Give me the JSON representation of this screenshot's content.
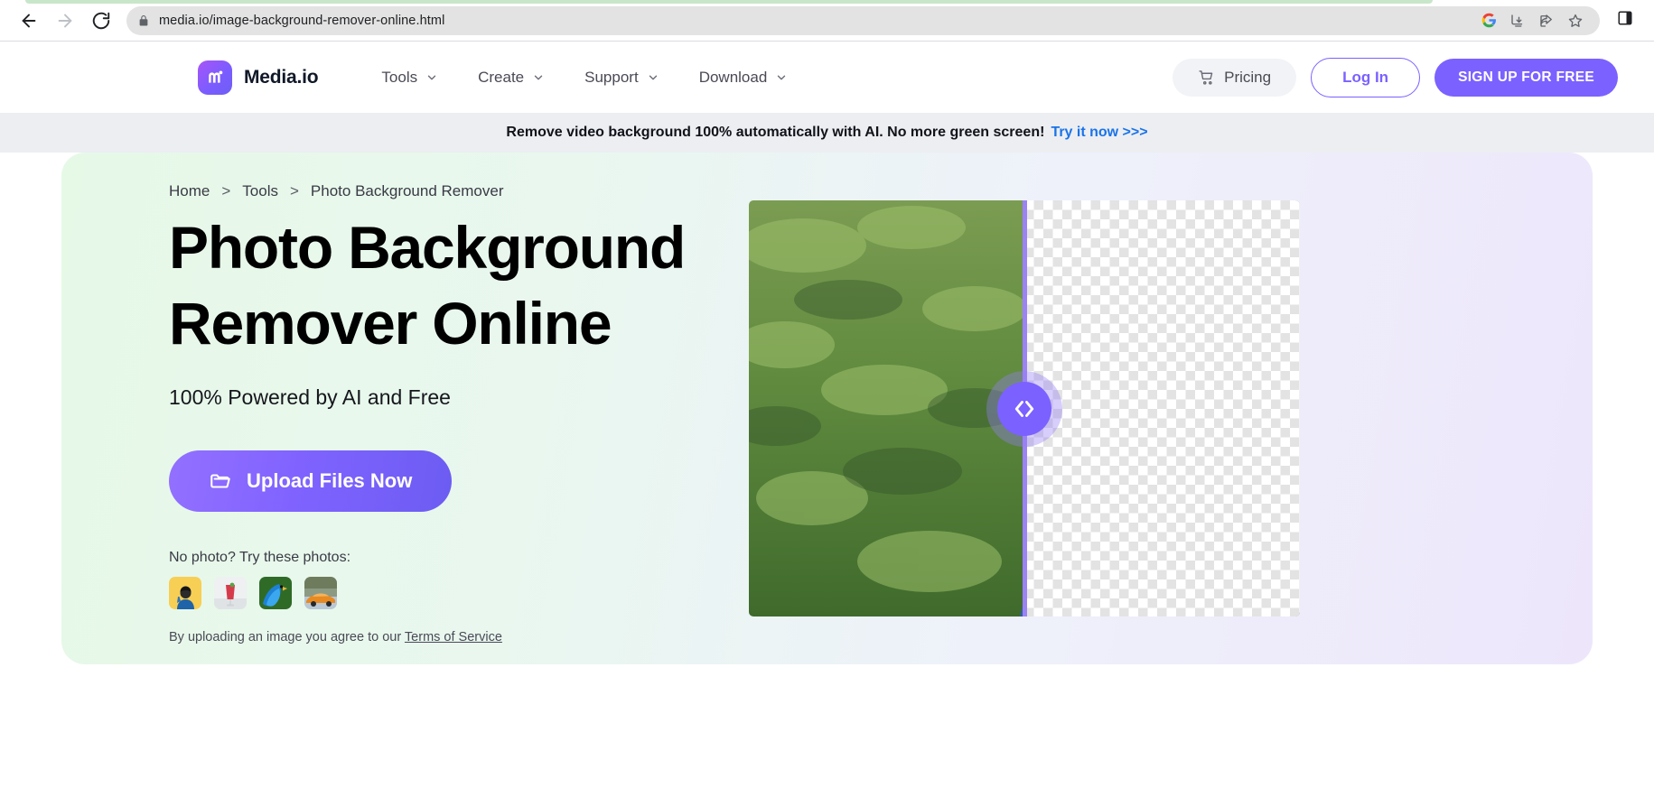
{
  "browser": {
    "back_icon": "back-arrow-icon",
    "forward_icon": "forward-arrow-icon",
    "reload_icon": "reload-icon",
    "lock_icon": "lock-icon",
    "url": "media.io/image-background-remover-online.html",
    "omni_icons": [
      "google-icon",
      "install-app-icon",
      "share-icon",
      "bookmark-star-icon"
    ],
    "sidebar_icon": "sidebar-toggle-icon"
  },
  "header": {
    "logo_icon": "media-io-logo-icon",
    "brand": "Media.io",
    "nav": [
      {
        "label": "Tools",
        "icon": "chevron-down-icon"
      },
      {
        "label": "Create",
        "icon": "chevron-down-icon"
      },
      {
        "label": "Support",
        "icon": "chevron-down-icon"
      },
      {
        "label": "Download",
        "icon": "chevron-down-icon"
      }
    ],
    "pricing": {
      "label": "Pricing",
      "icon": "cart-icon"
    },
    "login": "Log In",
    "signup": "SIGN UP FOR FREE"
  },
  "promo": {
    "text": "Remove video background 100% automatically with AI. No more green screen!",
    "link": "Try it now >>>",
    "link_color": "#1a73e8",
    "background": "#eceef2"
  },
  "hero": {
    "breadcrumb": [
      "Home",
      "Tools",
      "Photo Background Remover"
    ],
    "breadcrumb_separator": ">",
    "title_line1": "Photo Background",
    "title_line2": "Remover Online",
    "subtitle": "100% Powered by AI and Free",
    "upload_button": {
      "label": "Upload Files Now",
      "icon": "folder-icon",
      "color": "#7b61ff"
    },
    "try_photos_label": "No photo? Try these photos:",
    "thumbnails": [
      {
        "name": "thumbnail-person-yellow",
        "alt": "person in blue shirt on yellow background"
      },
      {
        "name": "thumbnail-drink",
        "alt": "red drink in glass"
      },
      {
        "name": "thumbnail-parrot",
        "alt": "blue macaw parrot"
      },
      {
        "name": "thumbnail-car",
        "alt": "orange sports car"
      }
    ],
    "terms_prefix": "By uploading an image you agree to our ",
    "terms_link": "Terms of Service",
    "compare": {
      "handle_icon": "compare-slider-handle-icon",
      "left_label": "original photo with green foliage background",
      "right_label": "transparent checkerboard background",
      "accent_color": "#7b61ff"
    },
    "background_gradient_start": "#e6f9e7",
    "background_gradient_end": "#ede6fb"
  }
}
